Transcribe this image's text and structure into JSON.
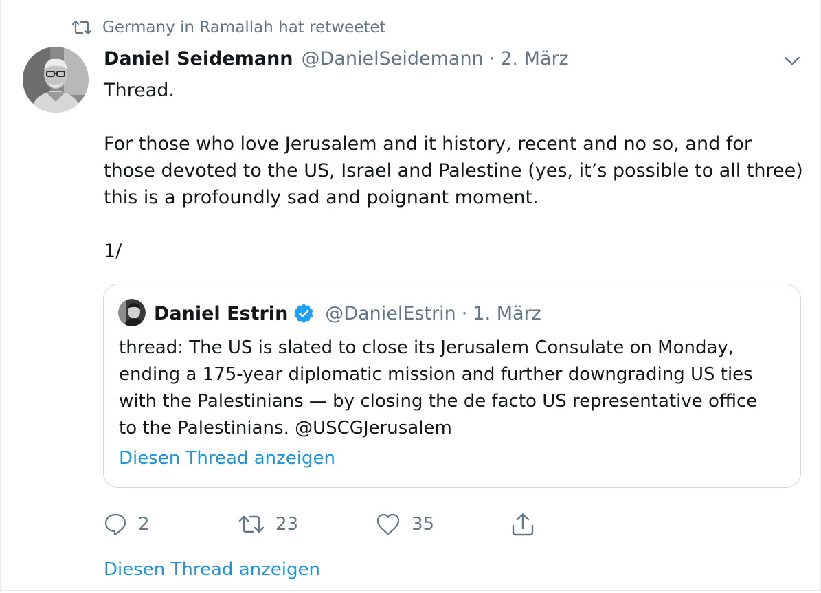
{
  "retweet_context": {
    "text": "Germany in Ramallah hat retweetet",
    "icon": "retweet-icon"
  },
  "tweet": {
    "author_name": "Daniel Seidemann",
    "author_handle": "@DanielSeidemann",
    "separator": "·",
    "date": "2. März",
    "paragraphs": [
      "Thread.",
      "For those who love Jerusalem and it history, recent and no so, and for those devoted to the US, Israel and Palestine (yes, it’s possible to all three) this is a profoundly sad and poignant moment.",
      "1/"
    ],
    "quoted": {
      "author_name": "Daniel Estrin",
      "author_handle": "@DanielEstrin",
      "separator": "·",
      "date": "1. März",
      "verified": true,
      "lines": [
        "thread: The US is slated to close its Jerusalem Consulate on Monday,",
        "ending a 175-year diplomatic mission and further downgrading US ties",
        "with the Palestinians — by closing the de facto US representative office",
        "to the Palestinians. @USCGJerusalem"
      ],
      "show_thread_label": "Diesen Thread anzeigen"
    },
    "actions": {
      "reply_count": "2",
      "retweet_count": "23",
      "like_count": "35"
    },
    "show_thread_label": "Diesen Thread anzeigen"
  },
  "colors": {
    "text": "#14171a",
    "secondary": "#657786",
    "link": "#1b95e0",
    "verified": "#1da1f2",
    "border": "#ccd6dd"
  }
}
